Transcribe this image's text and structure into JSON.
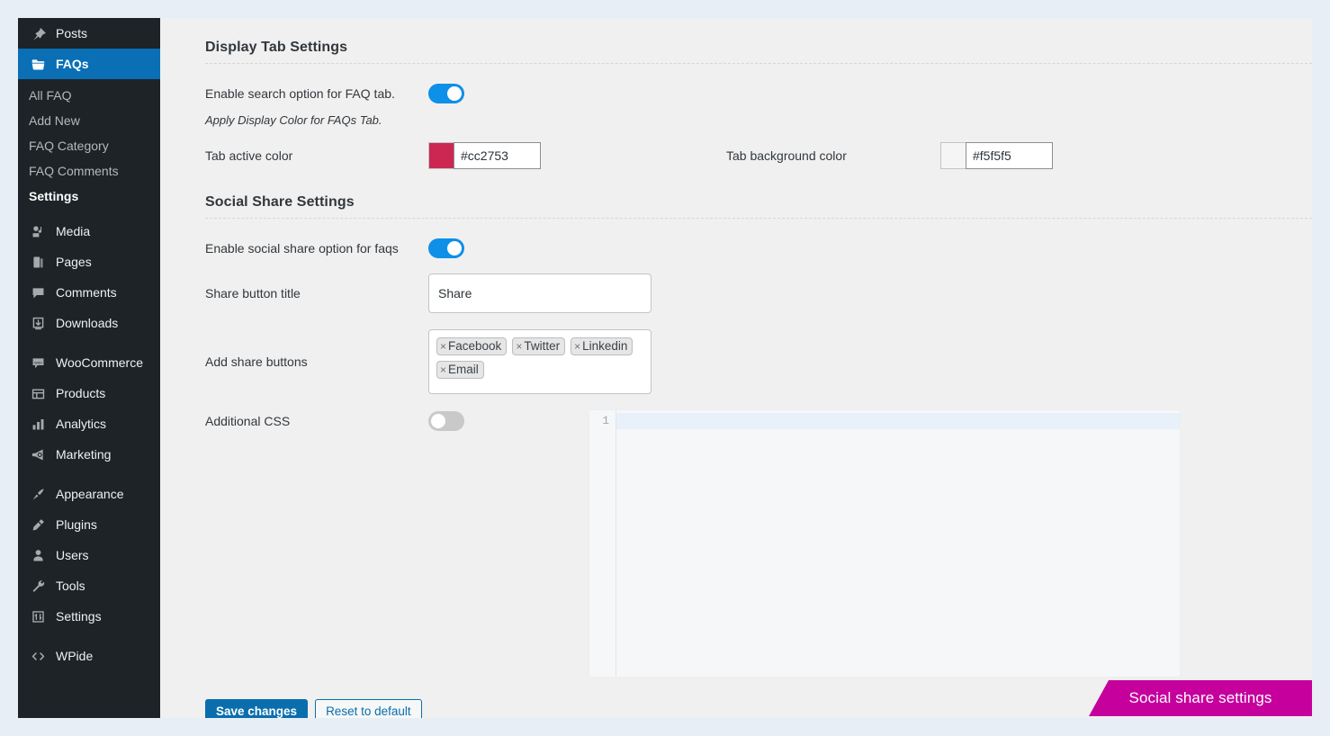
{
  "theme": {
    "page_bg": "#e8eef5",
    "sidebar_bg": "#1d2327",
    "content_bg": "#f0f0f0",
    "accent_blue": "#0a6fb5",
    "toggle_on": "#0e8fe8",
    "toggle_off": "#c9c9c9",
    "banner_pink": "#c5009c"
  },
  "sidebar": {
    "items": [
      {
        "label": "Posts",
        "icon": "pin-icon",
        "active": false
      },
      {
        "label": "FAQs",
        "icon": "folder-icon",
        "active": true
      },
      {
        "label": "Media",
        "icon": "media-icon",
        "active": false
      },
      {
        "label": "Pages",
        "icon": "pages-icon",
        "active": false
      },
      {
        "label": "Comments",
        "icon": "comment-icon",
        "active": false
      },
      {
        "label": "Downloads",
        "icon": "download-icon",
        "active": false
      },
      {
        "label": "WooCommerce",
        "icon": "woo-icon",
        "active": false
      },
      {
        "label": "Products",
        "icon": "products-icon",
        "active": false
      },
      {
        "label": "Analytics",
        "icon": "analytics-icon",
        "active": false
      },
      {
        "label": "Marketing",
        "icon": "megaphone-icon",
        "active": false
      },
      {
        "label": "Appearance",
        "icon": "brush-icon",
        "active": false
      },
      {
        "label": "Plugins",
        "icon": "plug-icon",
        "active": false
      },
      {
        "label": "Users",
        "icon": "user-icon",
        "active": false
      },
      {
        "label": "Tools",
        "icon": "wrench-icon",
        "active": false
      },
      {
        "label": "Settings",
        "icon": "sliders-icon",
        "active": false
      },
      {
        "label": "WPide",
        "icon": "code-icon",
        "active": false
      }
    ],
    "submenu": [
      {
        "label": "All FAQ",
        "current": false
      },
      {
        "label": "Add New",
        "current": false
      },
      {
        "label": "FAQ Category",
        "current": false
      },
      {
        "label": "FAQ Comments",
        "current": false
      },
      {
        "label": "Settings",
        "current": true
      }
    ]
  },
  "display_tab": {
    "heading": "Display Tab Settings",
    "enable_search_label": "Enable search option for FAQ tab.",
    "enable_search_state": "on",
    "note": "Apply Display Color for FAQs Tab.",
    "tab_active_color_label": "Tab active color",
    "tab_active_color_value": "#cc2753",
    "tab_background_color_label": "Tab background color",
    "tab_background_color_value": "#f5f5f5"
  },
  "social_share": {
    "heading": "Social Share Settings",
    "enable_label": "Enable social share option for faqs",
    "enable_state": "on",
    "share_title_label": "Share button title",
    "share_title_value": "Share",
    "share_title_placeholder": "Share",
    "add_buttons_label": "Add share buttons",
    "chips": [
      {
        "label": "Facebook",
        "remove": "×"
      },
      {
        "label": "Twitter",
        "remove": "×"
      },
      {
        "label": "Linkedin",
        "remove": "×"
      },
      {
        "label": "Email",
        "remove": "×"
      }
    ],
    "additional_css_label": "Additional CSS",
    "additional_css_state": "off",
    "editor": {
      "line_numbers": [
        "1"
      ],
      "content": ""
    }
  },
  "footer": {
    "save_label": "Save changes",
    "reset_label": "Reset to default"
  },
  "banner": {
    "text": "Social share settings"
  }
}
